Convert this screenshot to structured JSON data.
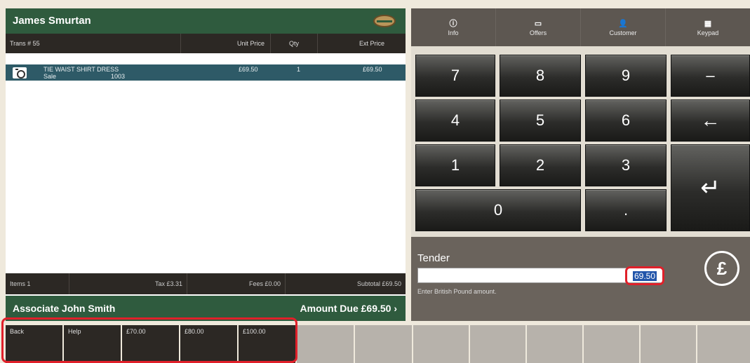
{
  "customer": {
    "name": "James Smurtan"
  },
  "table": {
    "columns": [
      "Trans # 55",
      "Unit Price",
      "Qty",
      "Ext Price"
    ],
    "items": [
      {
        "description": "TIE WAIST SHIRT DRESS",
        "type": "Sale",
        "sku": "1003",
        "unit_price": "£69.50",
        "qty": "1",
        "ext_price": "£69.50"
      }
    ]
  },
  "summary": {
    "items": "Items 1",
    "tax": "Tax £3.31",
    "fees": "Fees £0.00",
    "subtotal": "Subtotal £69.50"
  },
  "associate": {
    "label": "Associate John Smith",
    "amount_due": "Amount Due  £69.50 ›"
  },
  "tabs": [
    {
      "label": "Info",
      "icon": "info-icon"
    },
    {
      "label": "Offers",
      "icon": "offers-icon"
    },
    {
      "label": "Customer",
      "icon": "customer-icon"
    },
    {
      "label": "Keypad",
      "icon": "keypad-icon"
    }
  ],
  "keypad": {
    "k7": "7",
    "k8": "8",
    "k9": "9",
    "minus": "–",
    "k4": "4",
    "k5": "5",
    "k6": "6",
    "backspace": "←",
    "k1": "1",
    "k2": "2",
    "k3": "3",
    "enter": "↵",
    "k0": "0",
    "dot": "."
  },
  "tender": {
    "label": "Tender",
    "value": "69.50",
    "hint": "Enter British Pound amount.",
    "currency_symbol": "£"
  },
  "function_keys": [
    "Back",
    "Help",
    "£70.00",
    "£80.00",
    "£100.00"
  ],
  "colors": {
    "header_green": "#2f5b3e",
    "item_row": "#2e5a67",
    "dark": "#2c2824",
    "highlight_red": "#e0202a"
  }
}
